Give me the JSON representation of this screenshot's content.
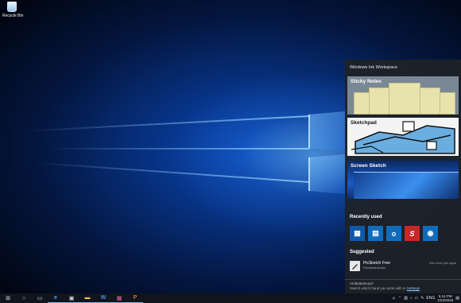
{
  "desktop": {
    "icons": [
      {
        "label": "Recycle Bin",
        "icon": "recycle-bin-icon"
      }
    ]
  },
  "ink_workspace": {
    "title": "Windows Ink Workspace",
    "cards": [
      {
        "label": "Sticky Notes"
      },
      {
        "label": "Sketchpad"
      },
      {
        "label": "Screen Sketch"
      }
    ],
    "recently_used_label": "Recently used",
    "recent_apps": [
      {
        "icon": "photos-app-icon",
        "color": "#0f5aa8",
        "glyph": "▦"
      },
      {
        "icon": "sticky-notes-app-icon",
        "color": "#0f6cbd",
        "glyph": "▤"
      },
      {
        "icon": "outlook-app-icon",
        "color": "#0f6cbd",
        "glyph": "o"
      },
      {
        "icon": "sketchable-app-icon",
        "color": "#c62828",
        "glyph": "S"
      },
      {
        "icon": "maps-app-icon",
        "color": "#0f6cbd",
        "glyph": "◉"
      }
    ],
    "suggested_label": "Suggested",
    "suggested_app": {
      "name": "PicSketch Free",
      "publisher": "Pixelbrainworks",
      "link": "Get more pen apps"
    },
    "ambidextrous_title": "Ambidextrous?",
    "ambidextrous_text": "Switch which hand you write with in",
    "settings_link": "Settings"
  },
  "taskbar": {
    "items": [
      {
        "icon": "start-windows-icon",
        "glyph": "⊞"
      },
      {
        "icon": "cortana-search-icon",
        "glyph": "○"
      },
      {
        "icon": "task-view-icon",
        "glyph": "▭"
      },
      {
        "icon": "edge-browser-icon",
        "glyph": "e"
      },
      {
        "icon": "store-icon",
        "glyph": "▣"
      },
      {
        "icon": "file-explorer-icon",
        "glyph": "▬"
      },
      {
        "icon": "word-icon",
        "glyph": "W"
      },
      {
        "icon": "photo-app-icon",
        "glyph": "▩"
      },
      {
        "icon": "powerpoint-icon",
        "glyph": "P"
      }
    ],
    "tray": {
      "language": "ENG",
      "time": "5:14 PM",
      "date": "1/24/2016"
    }
  }
}
